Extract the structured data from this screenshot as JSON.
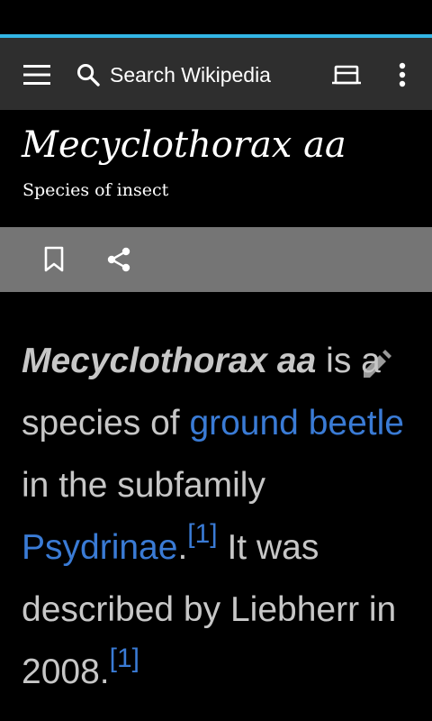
{
  "app": {
    "accent_color": "#33b5e5",
    "progress": 1.0
  },
  "toolbar": {
    "menu_icon": "hamburger-menu-icon",
    "search_icon": "search-icon",
    "search_placeholder": "Search Wikipedia",
    "reading_list_icon": "reading-lists-icon",
    "overflow_icon": "more-vertical-icon"
  },
  "article": {
    "title": "Mecyclothorax aa",
    "description": "Species of insect",
    "actions": {
      "bookmark_icon": "bookmark-icon",
      "share_icon": "share-icon"
    },
    "edit_icon": "pencil-edit-icon",
    "body": {
      "term": "Mecyclothorax aa",
      "text1": " is a species of ",
      "link1": "ground beetle",
      "text2": " in the subfamily ",
      "link2": "Psydrinae",
      "text3": ".",
      "ref1": "[1]",
      "text4": " It was described by Liebherr ",
      "text5": "in 2008.",
      "ref2": "[1]"
    }
  }
}
